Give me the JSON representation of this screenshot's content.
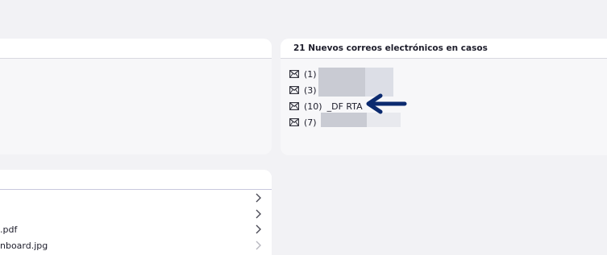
{
  "cases_panel": {
    "title": "21 Nuevos correos electrónicos en casos",
    "emails": [
      {
        "count": "(1)",
        "name": ""
      },
      {
        "count": "(3)",
        "name": ""
      },
      {
        "count": "(10)",
        "name": "_DF RTA"
      },
      {
        "count": "(7)",
        "name": ""
      }
    ]
  },
  "files_panel": {
    "items": [
      {
        "name": ""
      },
      {
        "name": ""
      },
      {
        "name": ".pdf"
      },
      {
        "name": "nboard.jpg"
      }
    ]
  },
  "icons": {
    "email": "envelope-icon",
    "row_chevron": "chevron-right-icon",
    "annotation": "arrow-left-icon"
  },
  "colors": {
    "background": "#f2f2f5",
    "panel": "#f7f7f9",
    "arrow": "#0b2a6f",
    "redaction": "#c9cbd3"
  }
}
